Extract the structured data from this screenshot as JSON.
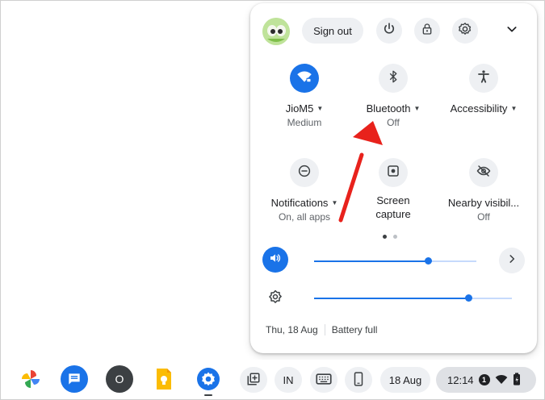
{
  "quick_settings": {
    "sign_out_label": "Sign out",
    "tiles": [
      {
        "label": "JioM5",
        "sub": "Medium",
        "icon": "wifi-icon",
        "active": true,
        "has_dropdown": true
      },
      {
        "label": "Bluetooth",
        "sub": "Off",
        "icon": "bluetooth-icon",
        "active": false,
        "has_dropdown": true
      },
      {
        "label": "Accessibility",
        "sub": "",
        "icon": "accessibility-icon",
        "active": false,
        "has_dropdown": true
      },
      {
        "label": "Notifications",
        "sub": "On, all apps",
        "icon": "do-not-disturb-icon",
        "active": false,
        "has_dropdown": true
      },
      {
        "label": "Screen",
        "label2": "capture",
        "sub": "",
        "icon": "screen-capture-icon",
        "active": false,
        "has_dropdown": false
      },
      {
        "label": "Nearby visibil...",
        "sub": "Off",
        "icon": "nearby-visibility-off-icon",
        "active": false,
        "has_dropdown": false
      }
    ],
    "pagination": {
      "pages": 2,
      "current": 1
    },
    "volume": {
      "level": 0.7
    },
    "brightness": {
      "level": 0.78
    },
    "footer": {
      "date": "Thu, 18 Aug",
      "battery": "Battery full"
    }
  },
  "shelf": {
    "apps": [
      "photos-app-icon",
      "messages-app-icon",
      "overview-app-icon",
      "keep-app-icon",
      "settings-app-icon"
    ],
    "overview_letter": "O",
    "ime_label": "IN",
    "date_label": "18 Aug",
    "time": "12:14",
    "notification_count": "1"
  },
  "colors": {
    "accent": "#1a73e8",
    "annotation": "#e8221c"
  }
}
